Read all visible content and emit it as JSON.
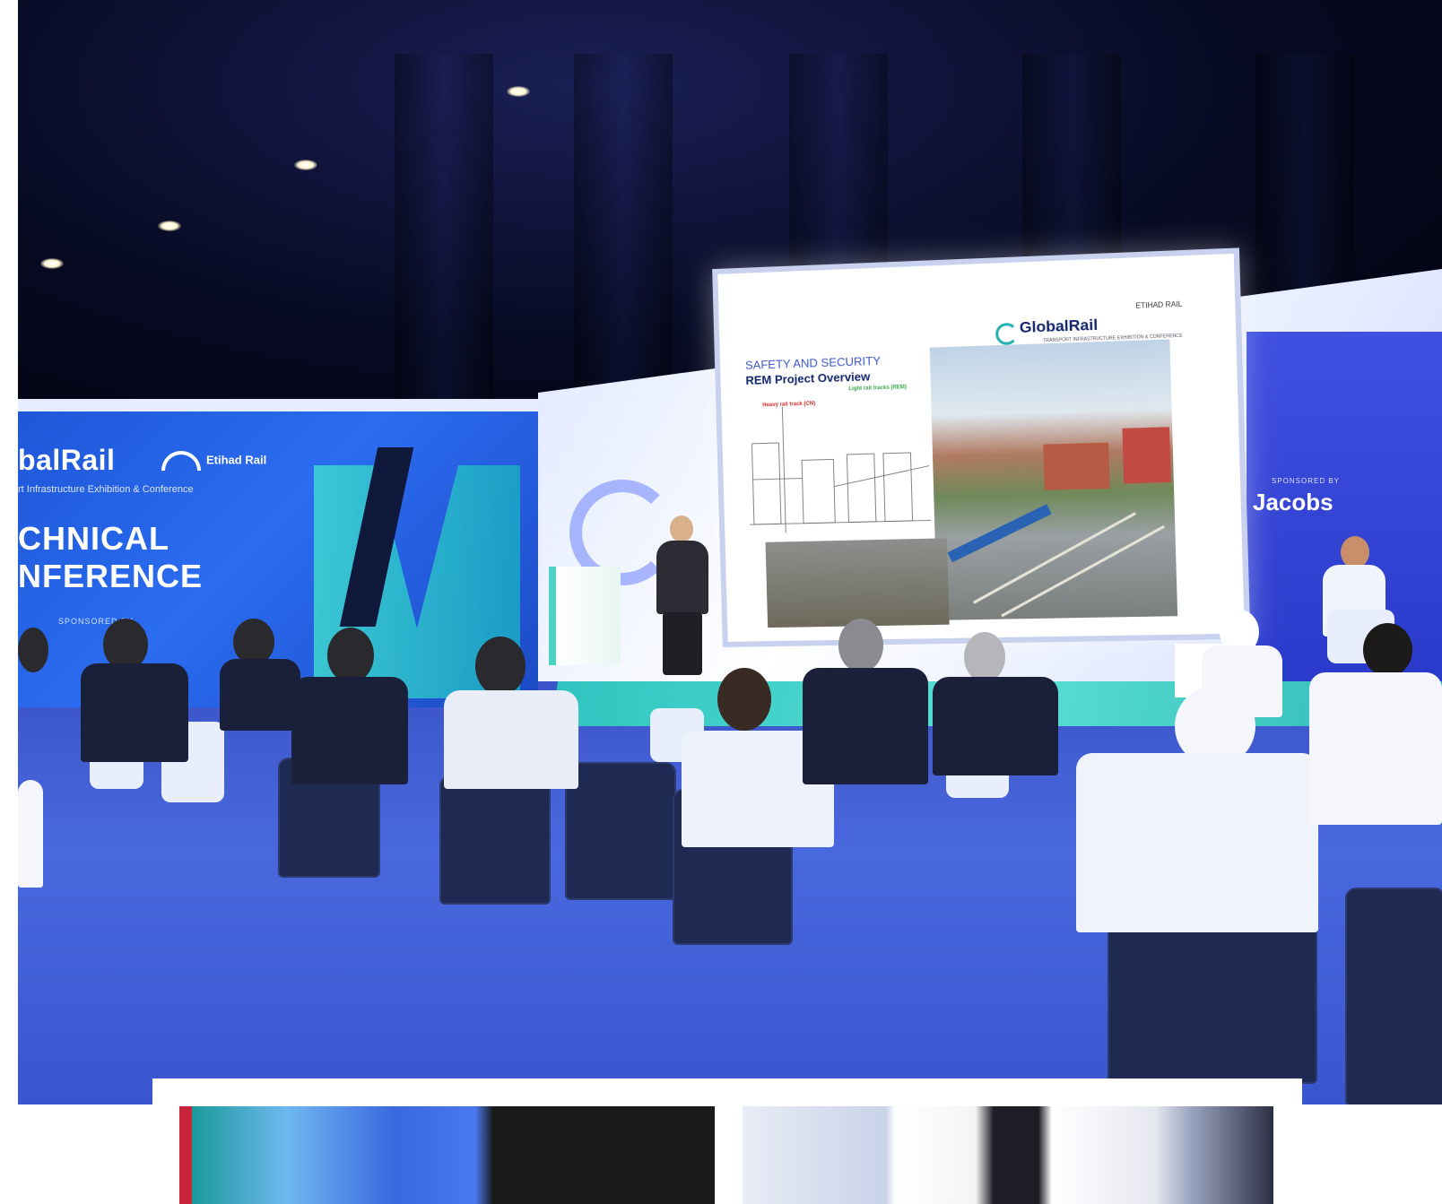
{
  "left_wall": {
    "brand": "balRail",
    "subtitle": "rt Infrastructure Exhibition & Conference",
    "headline_line1": "CHNICAL",
    "headline_line2": "NFERENCE",
    "partner": "Etihad Rail",
    "sponsored_by": "SPONSORED BY"
  },
  "right_wall": {
    "sponsor": "Jacobs",
    "sponsored_by": "SPONSORED BY"
  },
  "screen": {
    "title_line1": "SAFETY AND SECURITY",
    "title_line2": "REM Project Overview",
    "brand": "GlobalRail",
    "brand_subtitle": "TRANSPORT INFRASTRUCTURE EXHIBITION & CONFERENCE",
    "partner": "ETIHAD RAIL",
    "label_heavy": "Heavy rail track (CN)",
    "label_light": "Light rail tracks (REM)"
  },
  "colors": {
    "stage_blue": "#2b6cf0",
    "accent_teal": "#3fd8d0",
    "floor_blue": "#4a68de"
  }
}
